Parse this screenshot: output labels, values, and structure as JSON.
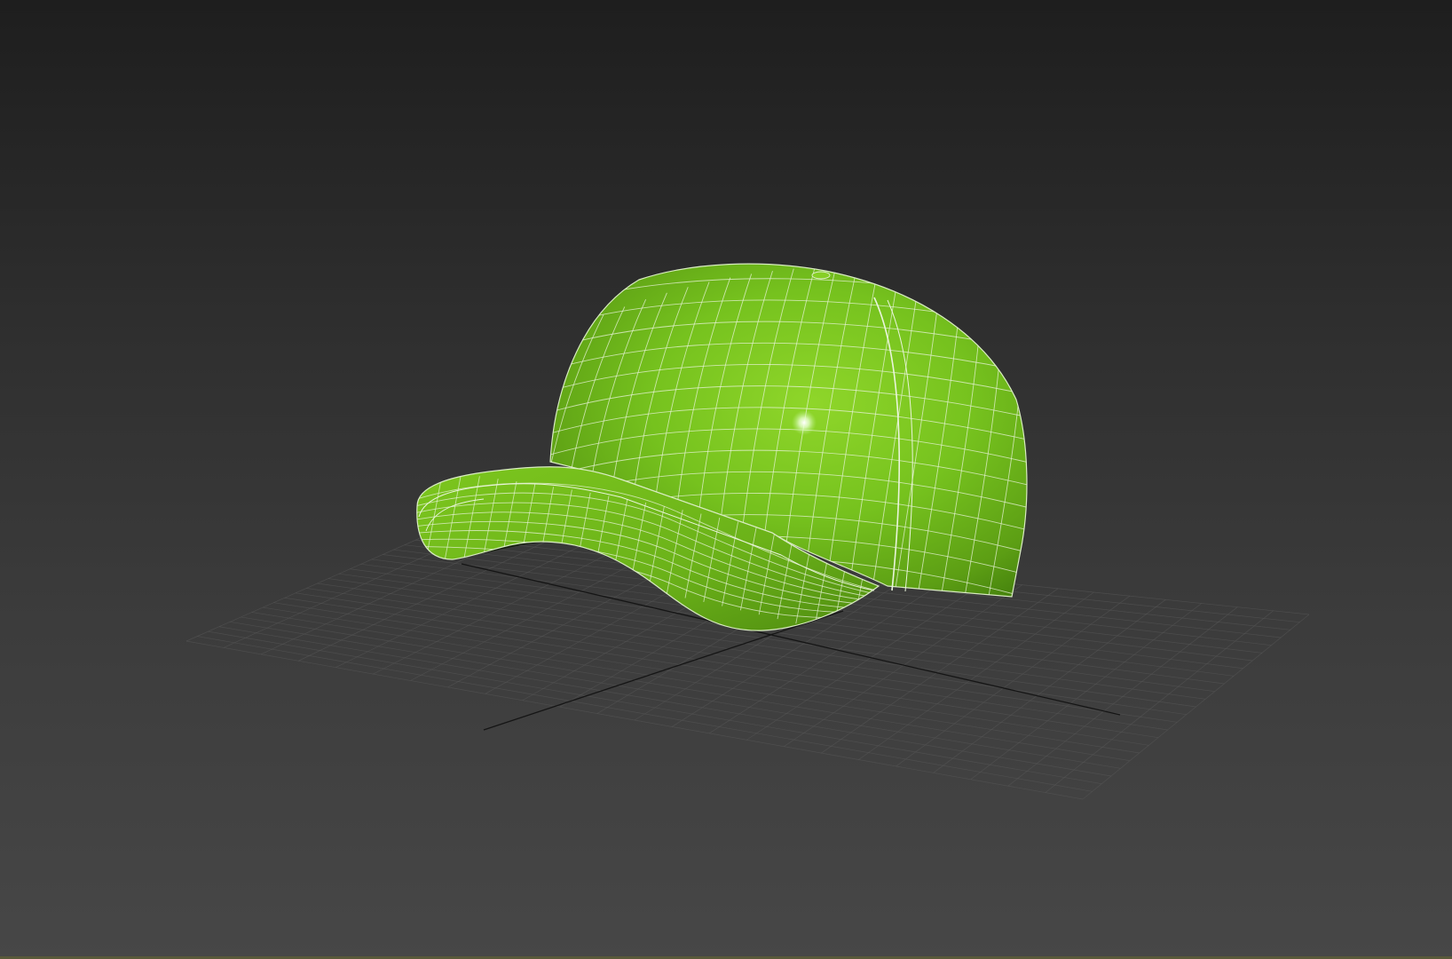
{
  "viewport": {
    "background_top": "#1e1e1e",
    "background_bottom": "#474747",
    "grid_color": "#5a5a5a",
    "axis_color": "#111111"
  },
  "model": {
    "object": "baseball-cap",
    "shading": "smooth-with-wireframe",
    "base_color": "#76c21e",
    "shadow_color": "#3d7a0c",
    "wire_color": "#e8f3d8",
    "highlight_color": "#ffffff"
  },
  "icons": {
    "cap": "cap-mesh-icon",
    "grid": "home-grid-icon"
  }
}
